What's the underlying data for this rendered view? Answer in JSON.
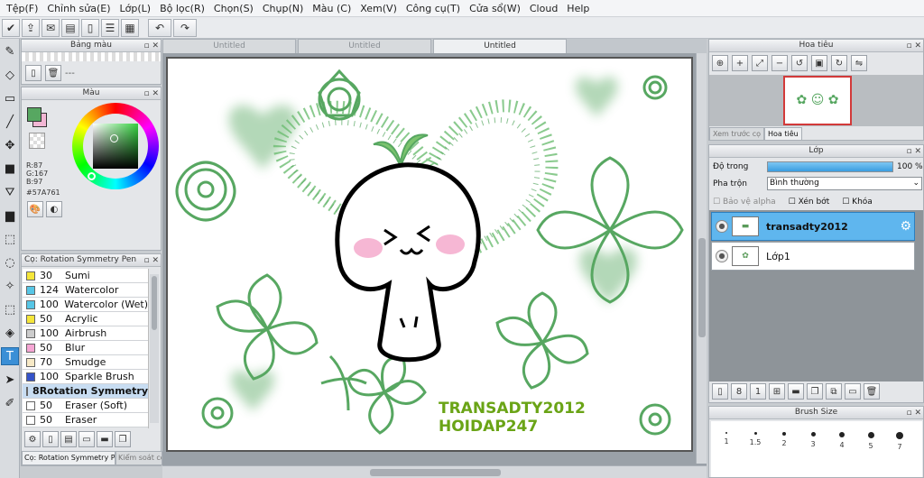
{
  "menu": [
    "Tệp(F)",
    "Chỉnh sửa(E)",
    "Lớp(L)",
    "Bộ lọc(R)",
    "Chọn(S)",
    "Chụp(N)",
    "Màu (C)",
    "Xem(V)",
    "Công cụ(T)",
    "Cửa sổ(W)",
    "Cloud",
    "Help"
  ],
  "palette_panel": {
    "title": "Bảng màu",
    "placeholder": "---"
  },
  "color_panel": {
    "title": "Màu",
    "r": "R:87",
    "g": "G:167",
    "b": "B:97",
    "hex": "#57A761",
    "current_color": "#57A761",
    "secondary_color": "#f2b6d4"
  },
  "brush_panel": {
    "title": "Cọ: Rotation Symmetry Pen",
    "footer_tab": "Cọ: Rotation Symmetry Pen",
    "footer_tab2": "Kiểm soát cọ",
    "items": [
      {
        "size": "30",
        "name": "Sumi",
        "color": "#f5e63a"
      },
      {
        "size": "124",
        "name": "Watercolor",
        "color": "#57c6e6"
      },
      {
        "size": "100",
        "name": "Watercolor (Wet)",
        "color": "#57c6e6"
      },
      {
        "size": "50",
        "name": "Acrylic",
        "color": "#f5e63a"
      },
      {
        "size": "100",
        "name": "Airbrush",
        "color": "#cccccc"
      },
      {
        "size": "50",
        "name": "Blur",
        "color": "#f6a6d4"
      },
      {
        "size": "70",
        "name": "Smudge",
        "color": "#f7e9c6"
      },
      {
        "size": "100",
        "name": "Sparkle Brush",
        "color": "#3553c9"
      },
      {
        "size": "8",
        "name": "Rotation Symmetry",
        "color": "#e33b3b"
      },
      {
        "size": "50",
        "name": "Eraser (Soft)",
        "color": "#ffffff"
      },
      {
        "size": "50",
        "name": "Eraser",
        "color": "#ffffff"
      }
    ]
  },
  "tabs": [
    "Untitled",
    "Untitled",
    "Untitled"
  ],
  "canvas_text": {
    "line1": "TRANSADTY2012",
    "line2": "HOIDAP247"
  },
  "navigator": {
    "title": "Hoa tiêu",
    "tab_preview": "Xem trước cọ",
    "tab_nav": "Hoa tiêu"
  },
  "layer_panel": {
    "title": "Lớp",
    "opacity_label": "Độ trong",
    "opacity_value": "100 %",
    "opacity_fraction": 1.0,
    "blend_label": "Pha trộn",
    "blend_value": "Bình thường",
    "protect_alpha": "Bảo vệ alpha",
    "clipping": "Xén bớt",
    "lock": "Khóa",
    "layers": [
      {
        "name": "transadty2012",
        "selected": true
      },
      {
        "name": "Lớp1",
        "selected": false
      }
    ]
  },
  "brush_size_panel": {
    "title": "Brush Size",
    "sizes": [
      "1",
      "1.5",
      "2",
      "3",
      "4",
      "5",
      "7"
    ]
  },
  "colors": {
    "accent_blue": "#3a8fd6",
    "stroke_green": "#57A761",
    "text_green": "#6aa416"
  }
}
